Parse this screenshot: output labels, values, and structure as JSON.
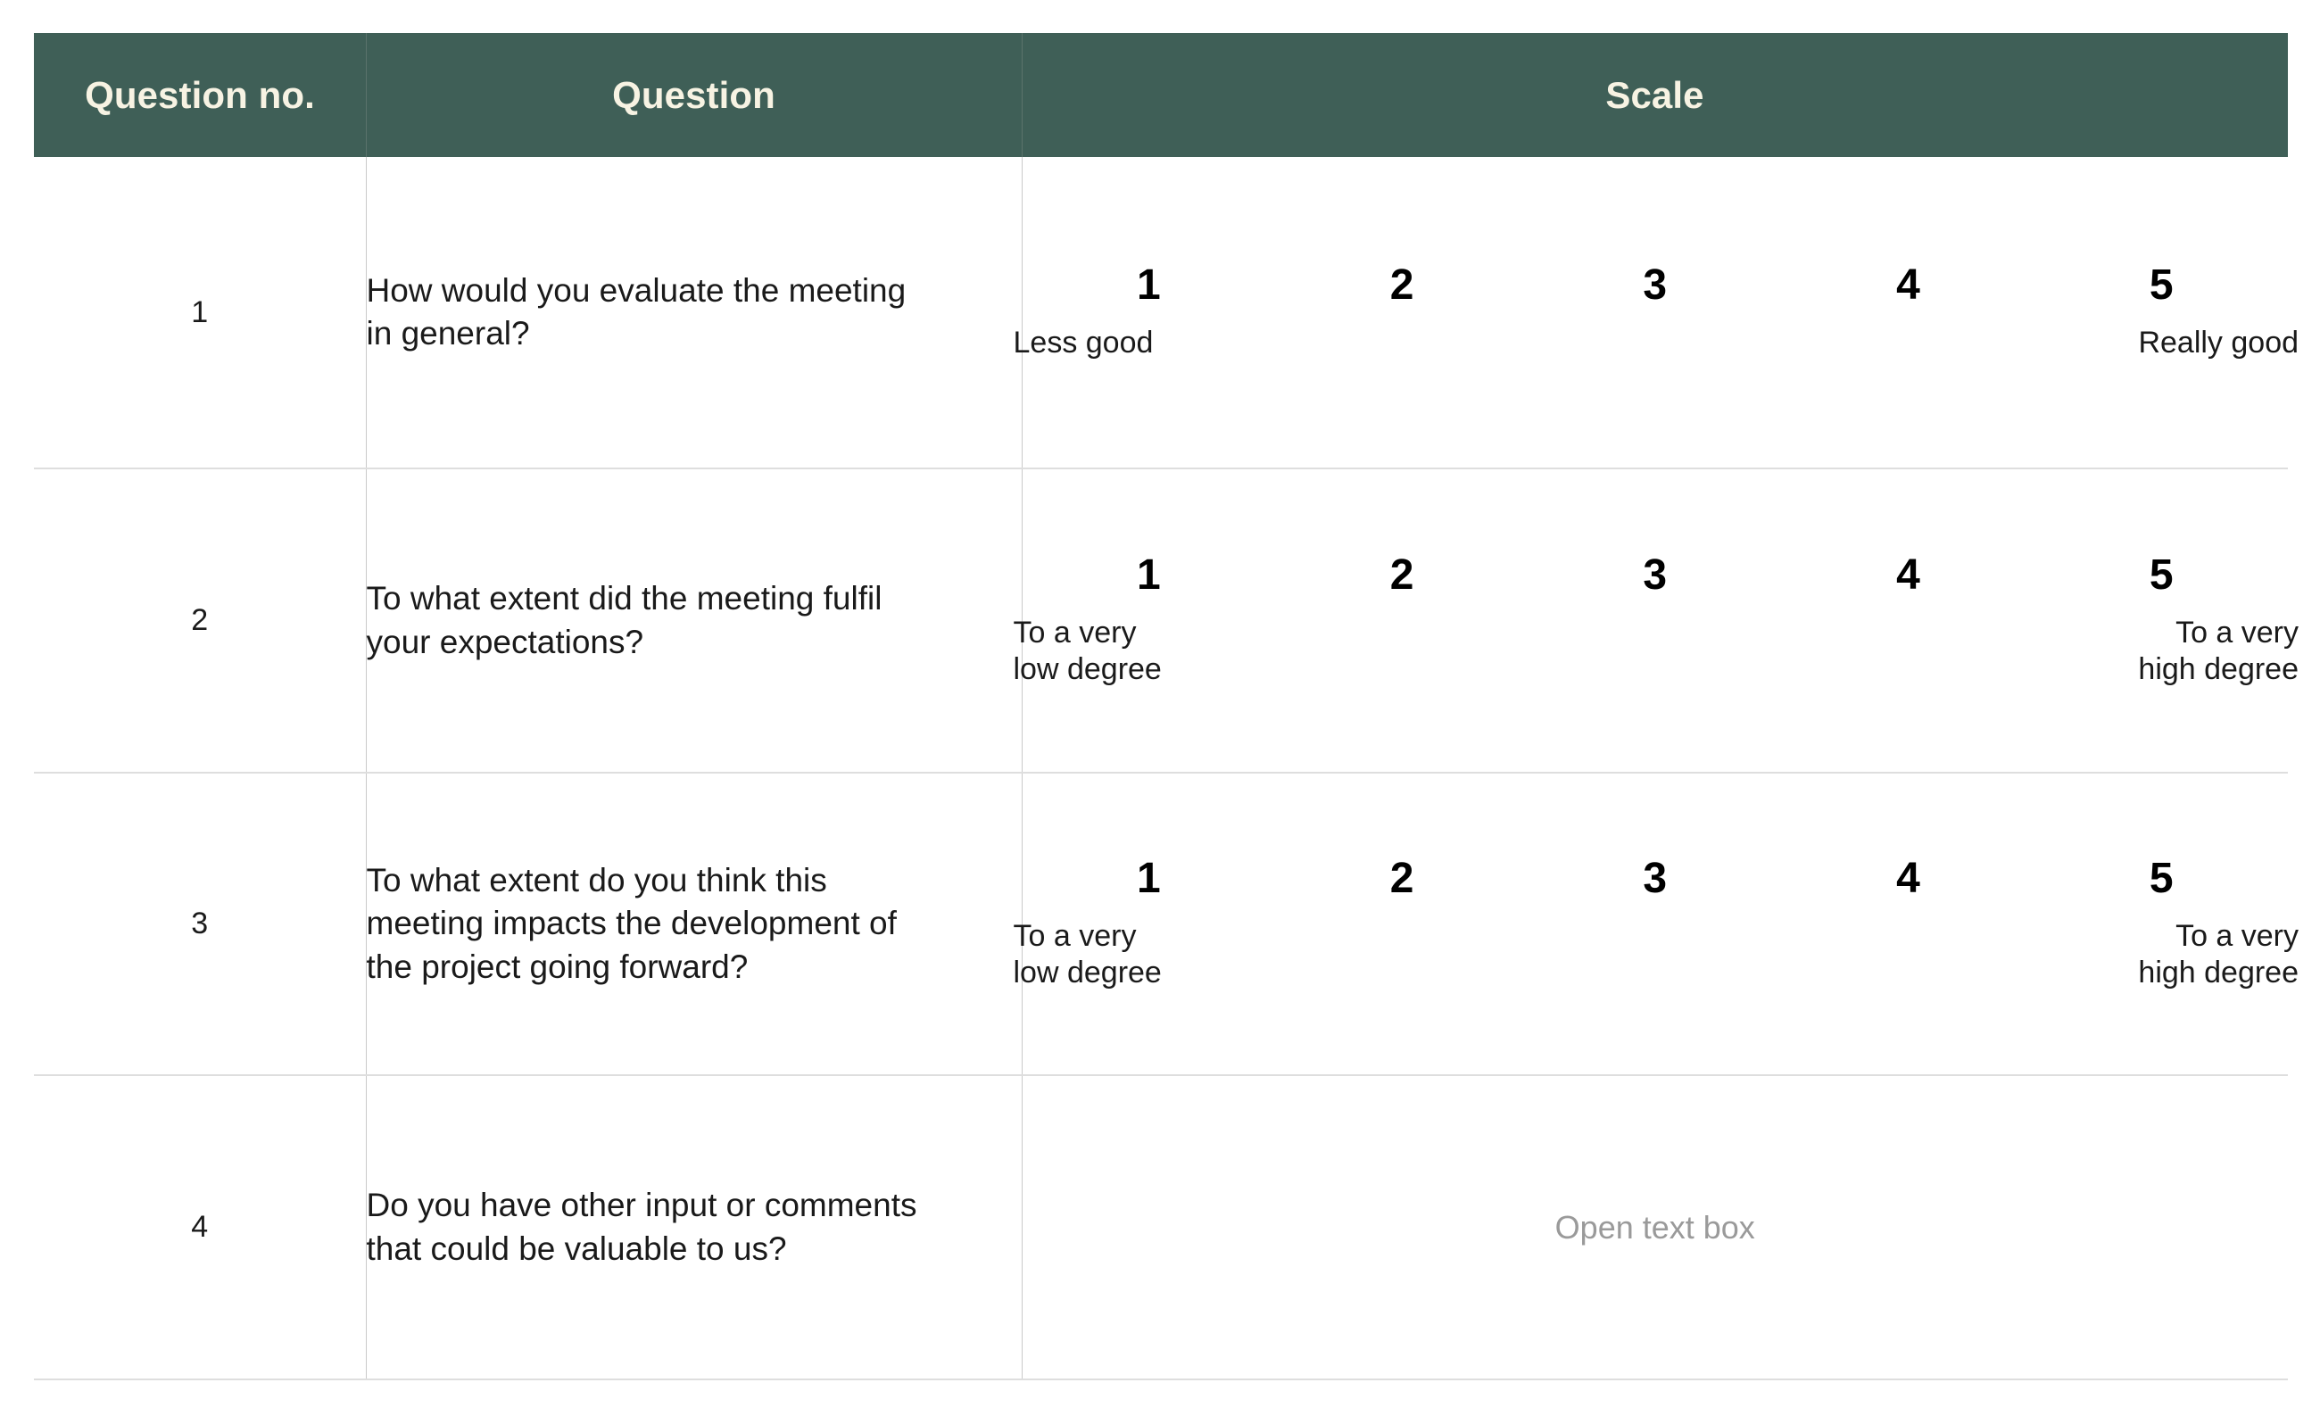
{
  "table": {
    "headers": {
      "question_no": "Question no.",
      "question": "Question",
      "scale": "Scale"
    },
    "header_bg_color": "#3f5f57",
    "header_text_color": "#f7f3e3",
    "rows": [
      {
        "number": "1",
        "question_lines": [
          "How would you evaluate the meeting",
          "in general?"
        ],
        "answer_type": "likert",
        "scale_numbers": [
          "1",
          "2",
          "3",
          "4",
          "5"
        ],
        "low_anchor_lines": [
          "Less good"
        ],
        "high_anchor_lines": [
          "Really good"
        ]
      },
      {
        "number": "2",
        "question_lines": [
          "To what extent did the meeting fulfil",
          "your expectations?"
        ],
        "answer_type": "likert",
        "scale_numbers": [
          "1",
          "2",
          "3",
          "4",
          "5"
        ],
        "low_anchor_lines": [
          "To a very",
          "low degree"
        ],
        "high_anchor_lines": [
          "To a very",
          "high degree"
        ]
      },
      {
        "number": "3",
        "question_lines": [
          "To what extent do you think this",
          "meeting impacts the development of",
          "the project going forward?"
        ],
        "answer_type": "likert",
        "scale_numbers": [
          "1",
          "2",
          "3",
          "4",
          "5"
        ],
        "low_anchor_lines": [
          "To a very",
          "low degree"
        ],
        "high_anchor_lines": [
          "To a very",
          "high degree"
        ]
      },
      {
        "number": "4",
        "question_lines": [
          "Do you have other input or comments",
          "that could be valuable to us?"
        ],
        "answer_type": "open_text",
        "open_text_placeholder": "Open text box"
      }
    ]
  }
}
